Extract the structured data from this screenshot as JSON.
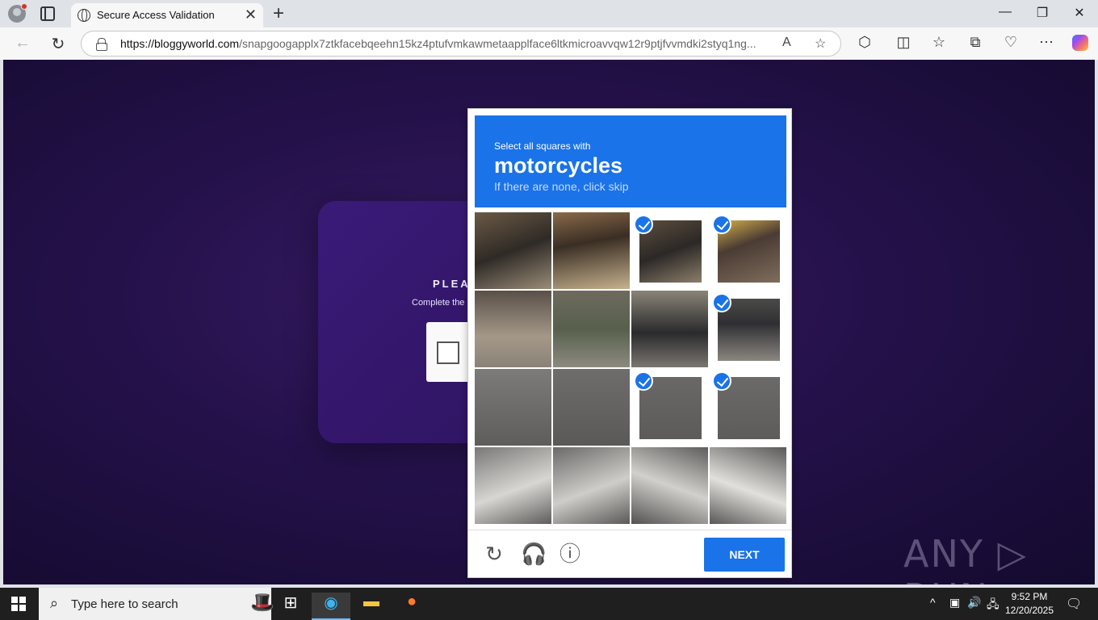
{
  "browser": {
    "tab_title": "Secure Access Validation",
    "tab_close": "✕",
    "new_tab": "+",
    "url_host": "https://bloggyworld.com",
    "url_path": "/snapgoogapplx7ztkfacebqeehn15kz4ptufvmkawmetaapplface6ltkmicroavvqw12r9ptjfvvmdki2styq1ng...",
    "window_controls": {
      "minimize": "—",
      "restore": "❐",
      "close": "✕"
    }
  },
  "background_page": {
    "heading": "PLEASE",
    "subtext": "Complete the"
  },
  "captcha": {
    "instruction": "Select all squares with",
    "target": "motorcycles",
    "hint": "If there are none, click skip",
    "next_label": "NEXT",
    "tiles": [
      {
        "row": 0,
        "col": 0,
        "selected": false
      },
      {
        "row": 0,
        "col": 1,
        "selected": false
      },
      {
        "row": 0,
        "col": 2,
        "selected": true
      },
      {
        "row": 0,
        "col": 3,
        "selected": true
      },
      {
        "row": 1,
        "col": 0,
        "selected": false
      },
      {
        "row": 1,
        "col": 1,
        "selected": false
      },
      {
        "row": 1,
        "col": 2,
        "selected": false
      },
      {
        "row": 1,
        "col": 3,
        "selected": true
      },
      {
        "row": 2,
        "col": 0,
        "selected": false
      },
      {
        "row": 2,
        "col": 1,
        "selected": false
      },
      {
        "row": 2,
        "col": 2,
        "selected": true
      },
      {
        "row": 2,
        "col": 3,
        "selected": true
      },
      {
        "row": 3,
        "col": 0,
        "selected": false
      },
      {
        "row": 3,
        "col": 1,
        "selected": false
      },
      {
        "row": 3,
        "col": 2,
        "selected": false
      },
      {
        "row": 3,
        "col": 3,
        "selected": false
      }
    ],
    "accent_color": "#1a73e8"
  },
  "watermark": "ANY ▷ RUN",
  "taskbar": {
    "search_placeholder": "Type here to search",
    "time": "9:52 PM",
    "date": "12/20/2025"
  }
}
